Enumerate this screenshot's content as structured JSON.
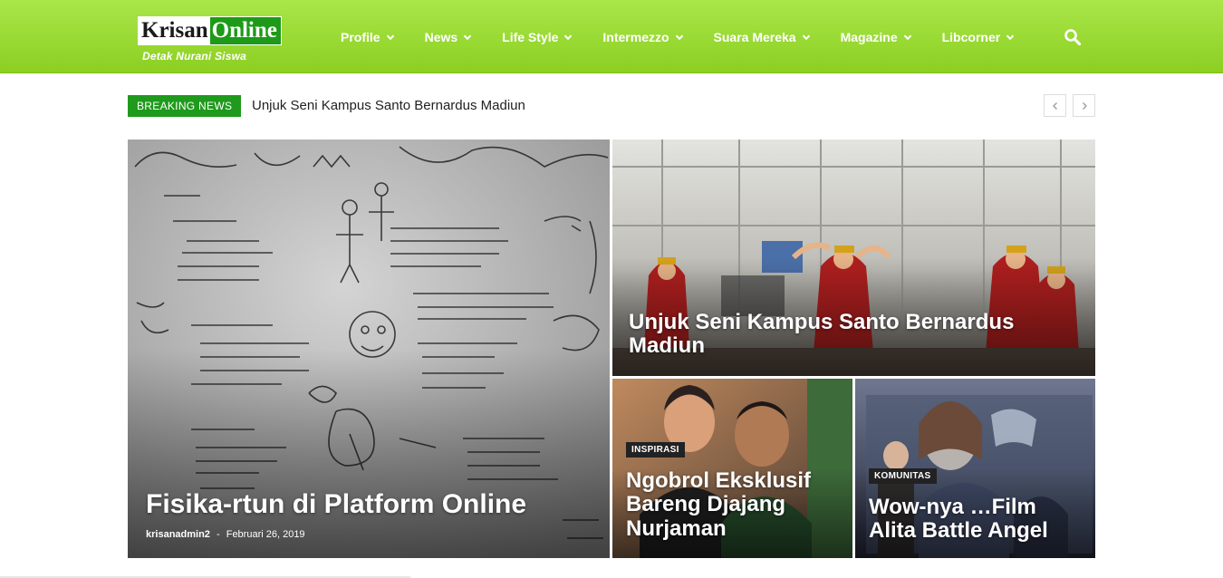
{
  "header": {
    "logo": {
      "part1": "Krisan",
      "part2": "Online",
      "tagline": "Detak Nurani Siswa"
    },
    "nav": [
      {
        "label": "Profile"
      },
      {
        "label": "News"
      },
      {
        "label": "Life Style"
      },
      {
        "label": "Intermezzo"
      },
      {
        "label": "Suara Mereka"
      },
      {
        "label": "Magazine"
      },
      {
        "label": "Libcorner"
      }
    ],
    "search_icon": "search-icon"
  },
  "breaking": {
    "badge": "BREAKING NEWS",
    "headline": "Unjuk Seni Kampus Santo Bernardus Madiun",
    "prev_icon": "chevron-left-icon",
    "next_icon": "chevron-right-icon"
  },
  "featured": {
    "main": {
      "title": "Fisika-rtun di Platform Online",
      "author": "krisanadmin2",
      "separator": "-",
      "date": "Februari 26, 2019"
    },
    "top_right": {
      "title": "Unjuk Seni Kampus Santo Bernardus Madiun"
    },
    "bottom_left": {
      "category": "INSPIRASI",
      "title": "Ngobrol Eksklusif Bareng Djajang Nurjaman"
    },
    "bottom_right": {
      "category": "KOMUNITAS",
      "title": "Wow-nya …Film Alita Battle Angel"
    }
  },
  "colors": {
    "brand_green": "#8ccf22",
    "badge_green": "#1f9a1d"
  }
}
